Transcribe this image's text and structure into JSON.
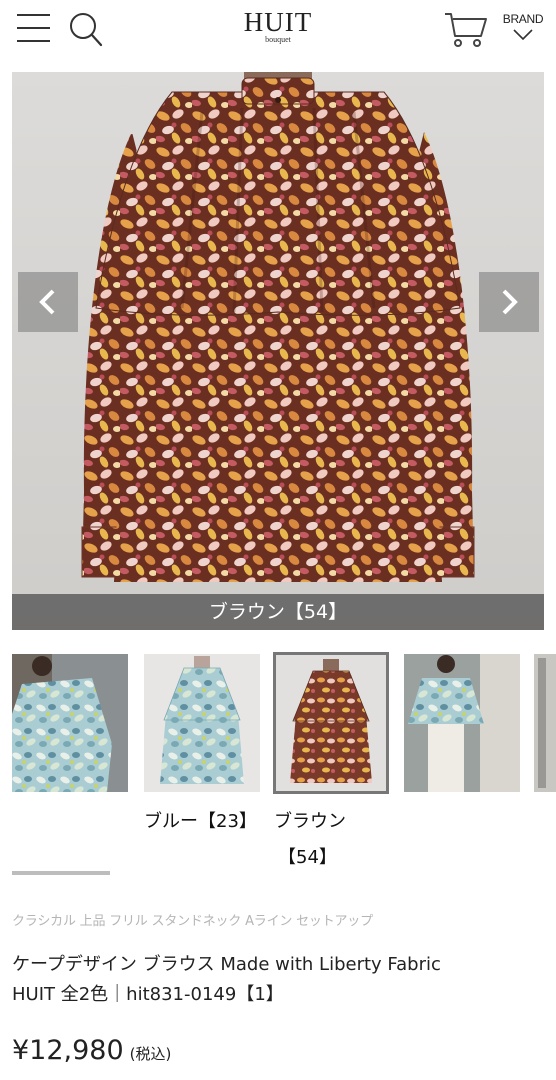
{
  "header": {
    "logo_main": "HUIT",
    "logo_sub": "bouquet",
    "brand_label": "BRAND"
  },
  "gallery": {
    "caption": "ブラウン【54】",
    "thumbnails": [
      {
        "label": "model-blue"
      },
      {
        "label": "blue"
      },
      {
        "label": "brown",
        "selected": true
      },
      {
        "label": "model-blue-2"
      }
    ],
    "color_options": [
      {
        "label": "ブルー【23】"
      },
      {
        "label": "ブラウン"
      },
      {
        "label": "【54】"
      }
    ]
  },
  "product": {
    "tags": "クラシカル 上品 フリル スタンドネック Aライン セットアップ",
    "title_line1": "ケープデザイン ブラウス Made with Liberty Fabric",
    "title_line2": "HUIT 全2色｜hit831-0149【1】",
    "price": "¥12,980",
    "tax_note": "(税込)"
  },
  "colors": {
    "brown_print": "#a0563a",
    "blue_print": "#8fb8bf",
    "overlay": "#5a5a5a"
  }
}
